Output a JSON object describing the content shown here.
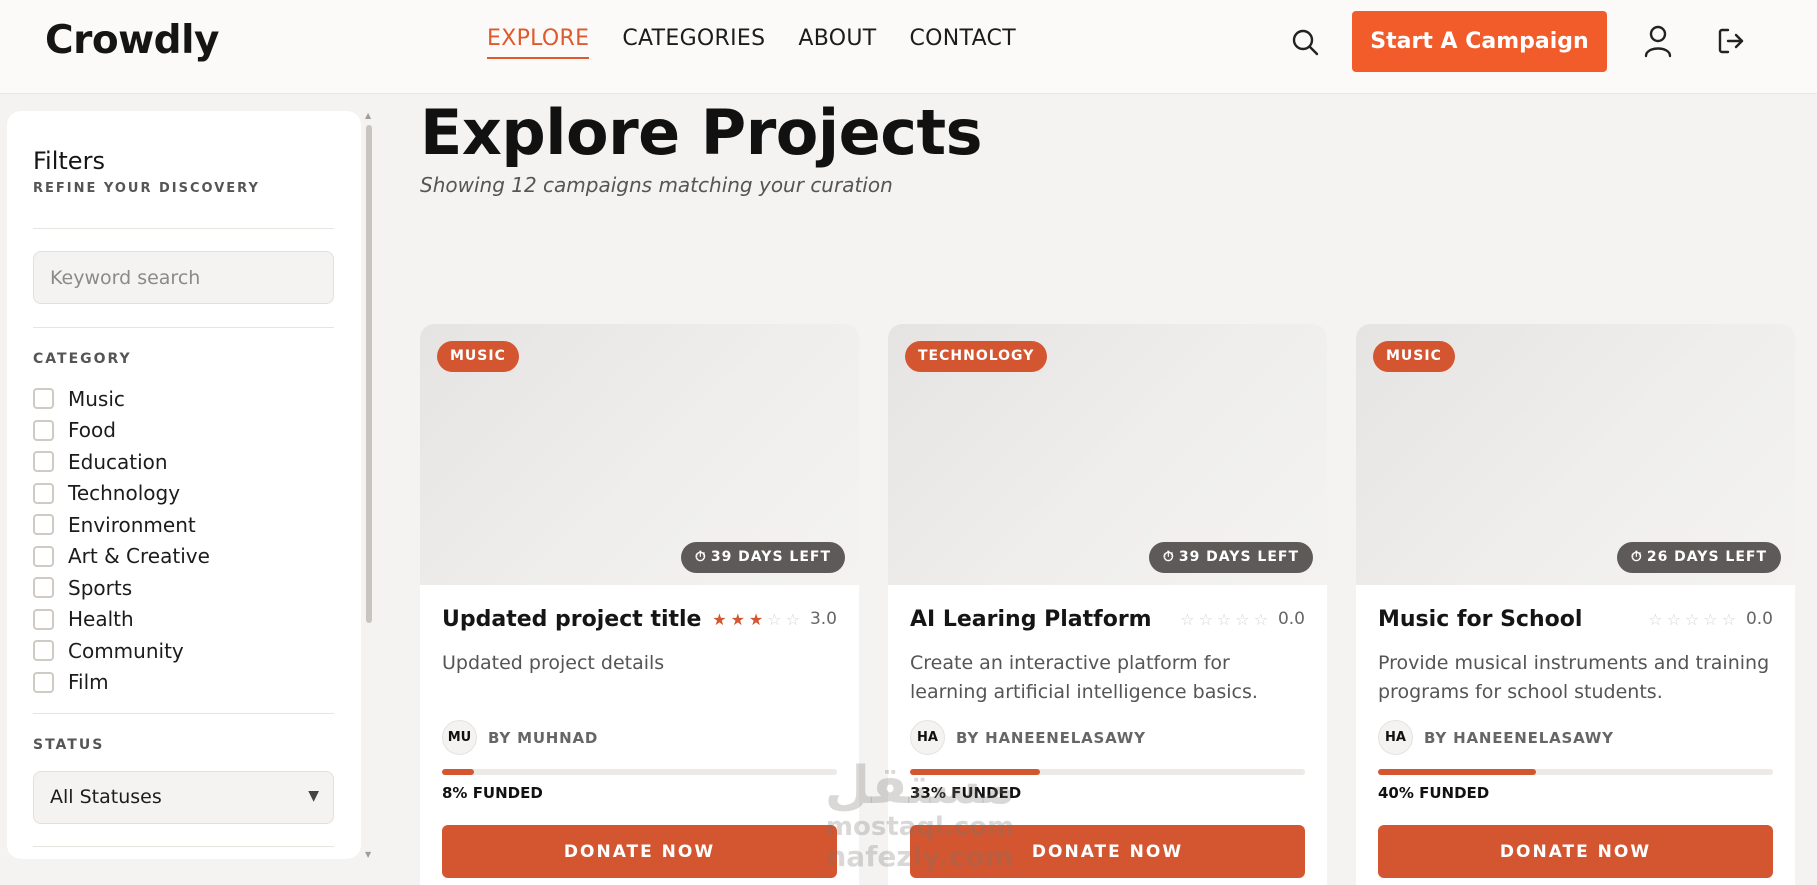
{
  "header": {
    "logo": "Crowdly",
    "nav": [
      {
        "label": "EXPLORE",
        "active": true
      },
      {
        "label": "CATEGORIES",
        "active": false
      },
      {
        "label": "ABOUT",
        "active": false
      },
      {
        "label": "CONTACT",
        "active": false
      }
    ],
    "cta_label": "Start A Campaign",
    "icons": {
      "search": "search-icon",
      "user": "user-icon",
      "logout": "logout-icon"
    },
    "accent_color": "#f25b2a"
  },
  "sidebar": {
    "title": "Filters",
    "subtitle": "REFINE YOUR DISCOVERY",
    "search_placeholder": "Keyword search",
    "category_label": "CATEGORY",
    "categories": [
      "Music",
      "Food",
      "Education",
      "Technology",
      "Environment",
      "Art & Creative",
      "Sports",
      "Health",
      "Community",
      "Film"
    ],
    "status_label": "STATUS",
    "status_value": "All Statuses"
  },
  "main": {
    "title": "Explore Projects",
    "subtitle": "Showing 12 campaigns matching your curation"
  },
  "projects": [
    {
      "category": "MUSIC",
      "days_left": "39 DAYS LEFT",
      "title": "Updated project title",
      "rating": 3,
      "rating_text": "3.0",
      "description": "Updated project details",
      "author_initials": "MU",
      "author": "BY MUHNAD",
      "funded_pct": 8,
      "funded_text": "8% FUNDED",
      "button": "DONATE NOW"
    },
    {
      "category": "TECHNOLOGY",
      "days_left": "39 DAYS LEFT",
      "title": "AI Learing Platform",
      "rating": 0,
      "rating_text": "0.0",
      "description": "Create an interactive platform for learning artificial intelligence basics.",
      "author_initials": "HA",
      "author": "BY HANEENELASAWY",
      "funded_pct": 33,
      "funded_text": "33% FUNDED",
      "button": "DONATE NOW"
    },
    {
      "category": "MUSIC",
      "days_left": "26 DAYS LEFT",
      "title": "Music for School",
      "rating": 0,
      "rating_text": "0.0",
      "description": "Provide musical instruments and training programs for school students.",
      "author_initials": "HA",
      "author": "BY HANEENELASAWY",
      "funded_pct": 40,
      "funded_text": "40% FUNDED",
      "button": "DONATE NOW"
    }
  ],
  "watermark": {
    "logo_text": "مستقل",
    "line1": "mostaql.com",
    "line2": "nafezly.com"
  }
}
